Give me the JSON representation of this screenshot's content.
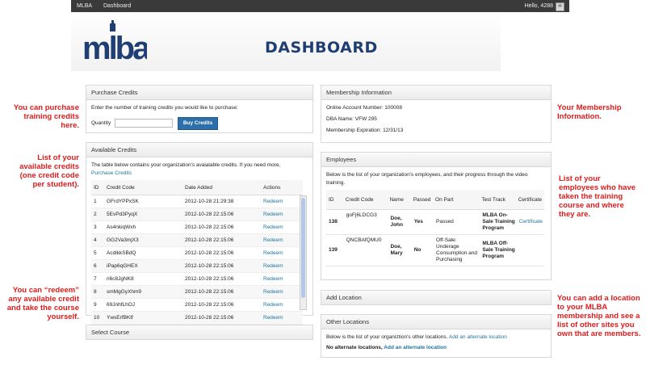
{
  "topbar": {
    "site": "MLBA",
    "nav": "Dashboard",
    "greeting": "Hello, 4288"
  },
  "banner": {
    "logo_text": "mlba",
    "title": "DASHBOARD"
  },
  "purchase": {
    "title": "Purchase Credits",
    "instruction": "Enter the number of training credits you would like to purchase:",
    "quantity_label": "Quantity",
    "button": "Buy Credits"
  },
  "available": {
    "title": "Available Credits",
    "intro": "The table below contains your organization's avaialable credits. If you need more,",
    "link": "Purchase Credits",
    "headers": [
      "ID",
      "Credit Code",
      "Date Added",
      "Actions"
    ],
    "rows": [
      [
        "1",
        "GFrdYPPxSK",
        "2012-10-28 21:29:38",
        "Redeem"
      ],
      [
        "2",
        "5EvPd3PyqX",
        "2012-10-28 22:15:06",
        "Redeem"
      ],
      [
        "3",
        "As4nkiqWxh",
        "2012-10-28 22:15:06",
        "Redeem"
      ],
      [
        "4",
        "GG2Va3mjX3",
        "2012-10-28 22:15:06",
        "Redeem"
      ],
      [
        "5",
        "AcdlkkSBdQ",
        "2012-10-28 22:15:06",
        "Redeem"
      ],
      [
        "6",
        "iPap6qGHEX",
        "2012-10-28 22:15:06",
        "Redeem"
      ],
      [
        "7",
        "ri6c8JgNK8",
        "2012-10-28 22:15:06",
        "Redeem"
      ],
      [
        "8",
        "smMgGyXhm9",
        "2012-10-28 22:15:06",
        "Redeem"
      ],
      [
        "9",
        "69JnhfLhOJ",
        "2012-10-28 22:15:06",
        "Redeem"
      ],
      [
        "10",
        "YwsErfBKtf",
        "2012-10-28 22:15:06",
        "Redeem"
      ]
    ]
  },
  "select_course": {
    "title": "Select Course"
  },
  "membership": {
    "title": "Membership Information",
    "account": "Online Account Number: 100008",
    "dba": "DBA Name: VFW 295",
    "expiration": "Membership Expiration: 12/31/13"
  },
  "employees": {
    "title": "Employees",
    "intro": "Below is the list of your organization's employees, and their progress through the video training.",
    "headers": [
      "ID",
      "Credit Code",
      "Name",
      "Passed",
      "On Part",
      "Test Track",
      "Certificate"
    ],
    "rows": [
      {
        "id": "138",
        "code": "goFj6LDCG3",
        "name": "Doe, John",
        "passed": "Yes",
        "part": "Passed",
        "track": "MLBA On-Sale Training Program",
        "cert": "Certificate"
      },
      {
        "id": "139",
        "code": "QNCBAfQMU0",
        "name": "Doe, Mary",
        "passed": "No",
        "part": "Off-Sale: Underage Consumption and Purchasing",
        "track": "MLBA Off-Sale Training Program",
        "cert": ""
      }
    ]
  },
  "add_location": {
    "title": "Add Location"
  },
  "other_locations": {
    "title": "Other Locations",
    "intro": "Below is the list of your organiztion's other locations.",
    "intro_link": "Add an alternate location",
    "empty": "No alternate locations,",
    "empty_link": "Add an alternate location"
  },
  "notes": {
    "purchase": "You can purchase training credits here.",
    "list": "List of your available credits (one credit code per student).",
    "redeem": "You can “redeem” any available credit and take the course yourself.",
    "membership": "Your Membership Information.",
    "employees": "List of your employees who have taken the training course and where they are.",
    "location": "You can add a location to your MLBA membership and see a list of other sites you own that are members."
  },
  "colors": {
    "accent": "#21759b",
    "note": "#e01b1b",
    "brand": "#1f3f74"
  }
}
